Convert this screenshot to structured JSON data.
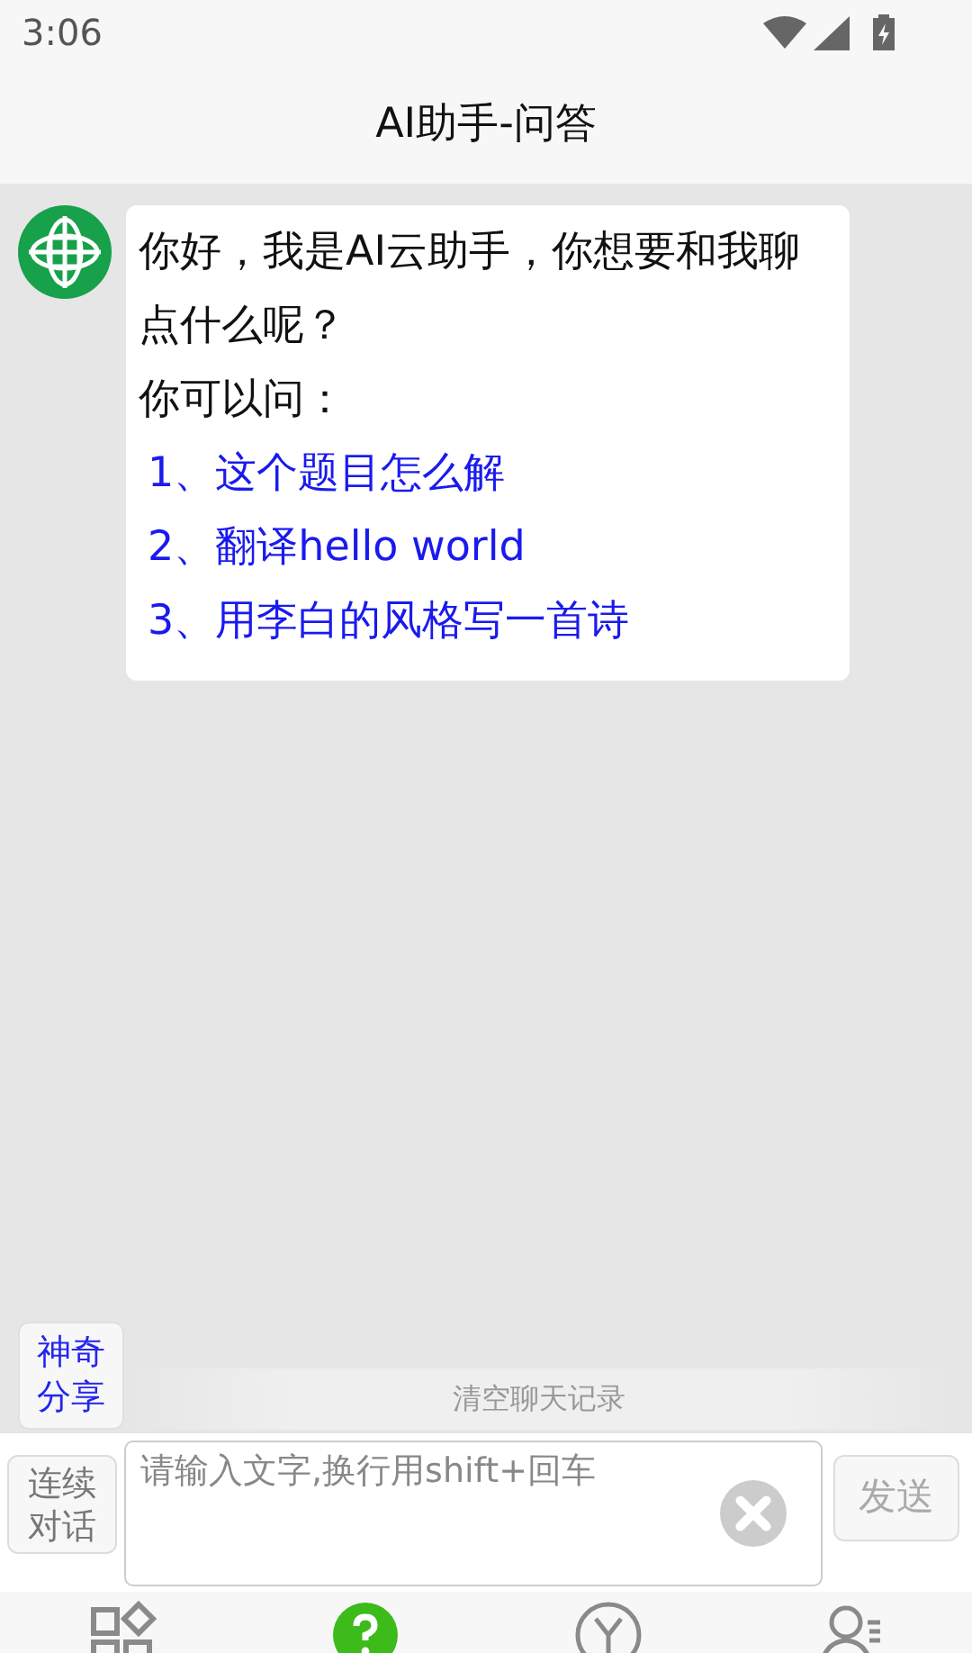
{
  "status_bar": {
    "time": "3:06"
  },
  "header": {
    "title": "AI助手-问答"
  },
  "messages": [
    {
      "kind": "assistant",
      "greeting": "你好，我是AI云助手，你想要和我聊点什么呢？",
      "prompt": "你可以问：",
      "suggestions": [
        "1、这个题目怎么解",
        "2、翻译hello world",
        "3、用李白的风格写一首诗"
      ]
    }
  ],
  "share_button": {
    "label": "神奇分享"
  },
  "clear_history": {
    "label": "清空聊天记录"
  },
  "continuous_button": {
    "label": "连续对话",
    "on": false
  },
  "input": {
    "placeholder": "请输入文字,换行用shift+回车"
  },
  "send_button": {
    "label": "发送",
    "disabled": true
  },
  "tabs": [
    {
      "kind": "apps",
      "selected": false
    },
    {
      "kind": "help",
      "selected": true
    },
    {
      "kind": "yen",
      "selected": false
    },
    {
      "kind": "profile",
      "selected": false
    }
  ]
}
